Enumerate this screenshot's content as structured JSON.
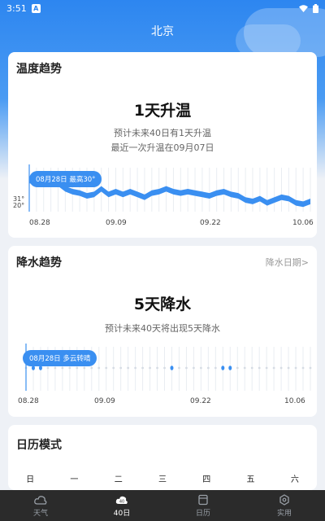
{
  "status": {
    "time": "3:51",
    "badge": "A"
  },
  "header": {
    "city": "北京"
  },
  "temp_card": {
    "title": "温度趋势",
    "headline": "1天升温",
    "line1": "预计未来40日有1天升温",
    "line2": "最近一次升温在09月07日",
    "tooltip": "08月28日 最高30°",
    "y_high": "31°",
    "y_low": "20°",
    "x_labels": [
      "08.28",
      "09.09",
      "09.22",
      "10.06"
    ]
  },
  "rain_card": {
    "title": "降水趋势",
    "link": "降水日期>",
    "headline": "5天降水",
    "line1": "预计未来40天将出现5天降水",
    "tooltip": "08月28日 多云转晴",
    "x_labels": [
      "08.28",
      "09.09",
      "09.22",
      "10.06"
    ]
  },
  "calendar_card": {
    "title": "日历模式",
    "weekdays": [
      "日",
      "一",
      "二",
      "三",
      "四",
      "五",
      "六"
    ]
  },
  "tabs": [
    {
      "label": "天气",
      "icon": "cloud-icon"
    },
    {
      "label": "40日",
      "icon": "40-day-icon"
    },
    {
      "label": "日历",
      "icon": "calendar-icon"
    },
    {
      "label": "实用",
      "icon": "tools-icon"
    }
  ],
  "colors": {
    "accent": "#2d86f0",
    "line": "#3a8ff1"
  },
  "chart_data": [
    {
      "type": "line",
      "x": [
        "08.28",
        "08.29",
        "08.30",
        "08.31",
        "09.01",
        "09.02",
        "09.03",
        "09.04",
        "09.05",
        "09.06",
        "09.07",
        "09.08",
        "09.09",
        "09.10",
        "09.11",
        "09.12",
        "09.13",
        "09.14",
        "09.15",
        "09.16",
        "09.17",
        "09.18",
        "09.19",
        "09.20",
        "09.21",
        "09.22",
        "09.23",
        "09.24",
        "09.25",
        "09.26",
        "09.27",
        "09.28",
        "09.29",
        "09.30",
        "10.01",
        "10.02",
        "10.03",
        "10.04",
        "10.05",
        "10.06"
      ],
      "series": [
        {
          "values": [
            29.5,
            28.5,
            30,
            29,
            28.5,
            26,
            25,
            24.5,
            23.5,
            24,
            26,
            24,
            25,
            24,
            25,
            24,
            23,
            24.5,
            25,
            26,
            25,
            24.5,
            25,
            24.5,
            24,
            23.5,
            24.5,
            25,
            24,
            23.5,
            22,
            21.5,
            22.5,
            21,
            22,
            23,
            22.5,
            21,
            20.5,
            21.5
          ]
        },
        {
          "values": [
            27,
            26.5,
            27.5,
            26.5,
            26,
            24,
            23,
            22.5,
            21.5,
            22,
            24,
            22,
            23,
            22,
            23,
            22,
            21,
            22.5,
            23,
            24,
            23,
            22.5,
            23,
            22.5,
            22,
            21.5,
            22.5,
            23,
            22,
            21.5,
            20,
            19.5,
            20.5,
            19,
            20,
            21,
            20.5,
            19,
            18.5,
            19.5
          ]
        }
      ],
      "yticks": [
        "31°",
        "20°"
      ],
      "xticks": [
        "08.28",
        "09.09",
        "09.22",
        "10.06"
      ],
      "ylim": [
        18,
        32
      ]
    },
    {
      "type": "scatter",
      "x_count": 40,
      "rain_day_index": [
        1,
        2,
        20,
        27,
        28
      ],
      "xticks": [
        "08.28",
        "09.09",
        "09.22",
        "10.06"
      ]
    }
  ]
}
